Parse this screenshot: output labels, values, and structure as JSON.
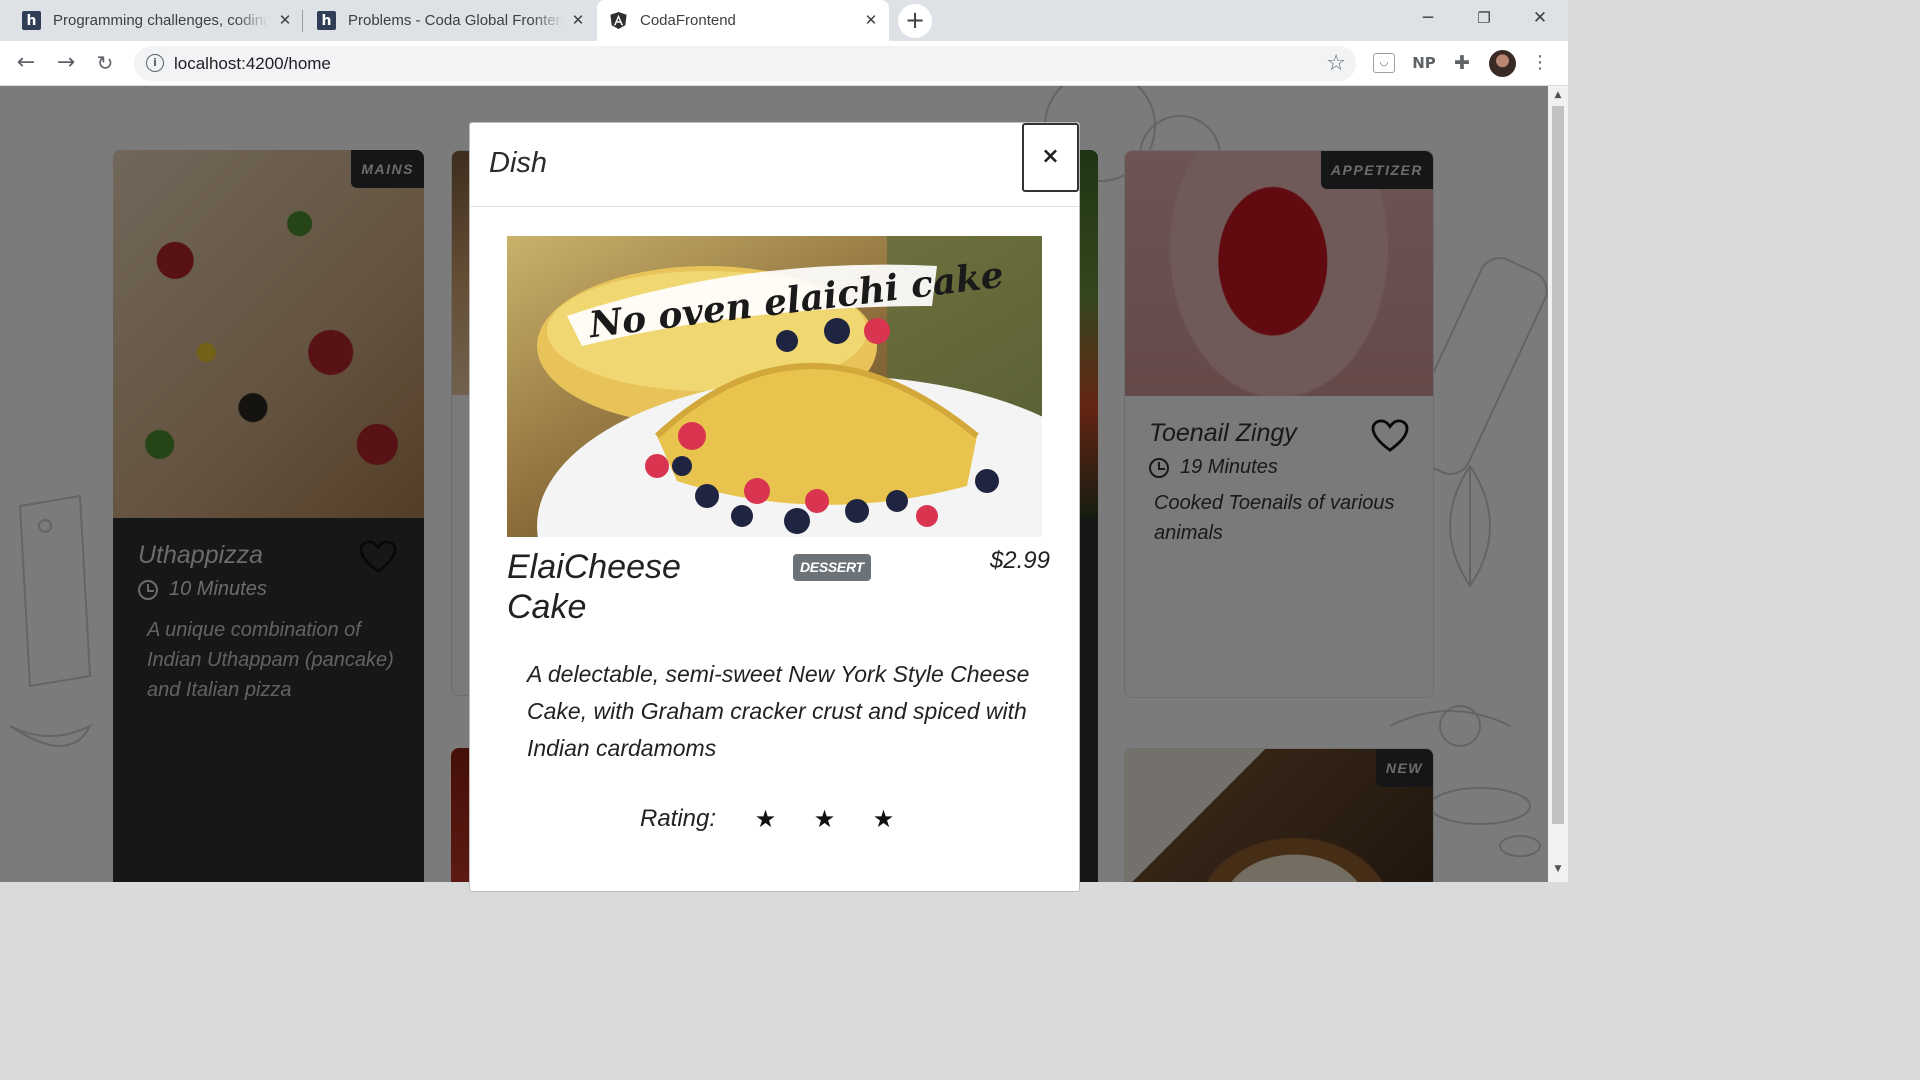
{
  "browser": {
    "tabs": [
      {
        "title": "Programming challenges, coding",
        "icon": "h"
      },
      {
        "title": "Problems - Coda Global Frontend",
        "icon": "h"
      },
      {
        "title": "CodaFrontend",
        "icon": "angular-icon"
      }
    ],
    "address": "localhost:4200/home",
    "extension_label": "NP"
  },
  "cards": [
    {
      "category": "MAINS",
      "name": "Uthappizza",
      "time": "10 Minutes",
      "description": "A unique combination of Indian Uthappam (pancake) and Italian pizza"
    },
    {
      "category": "APPETIZER",
      "name": "Toenail Zingy",
      "time": "19 Minutes",
      "description": "Cooked Toenails of various animals"
    },
    {
      "category": "NEW"
    }
  ],
  "modal": {
    "title": "Dish",
    "close": "×",
    "image_caption": "No oven elaichi cake",
    "dish_name": "ElaiCheese Cake",
    "category": "DESSERT",
    "price": "$2.99",
    "description": "A delectable, semi-sweet New York Style Cheese Cake, with Graham cracker crust and spiced with Indian cardamoms",
    "rating_label": "Rating:",
    "rating": 3
  },
  "colors": {
    "dark_card": "#2d2f31",
    "badge": "#6b7379",
    "overlay": "rgba(0,0,0,0.5)"
  }
}
